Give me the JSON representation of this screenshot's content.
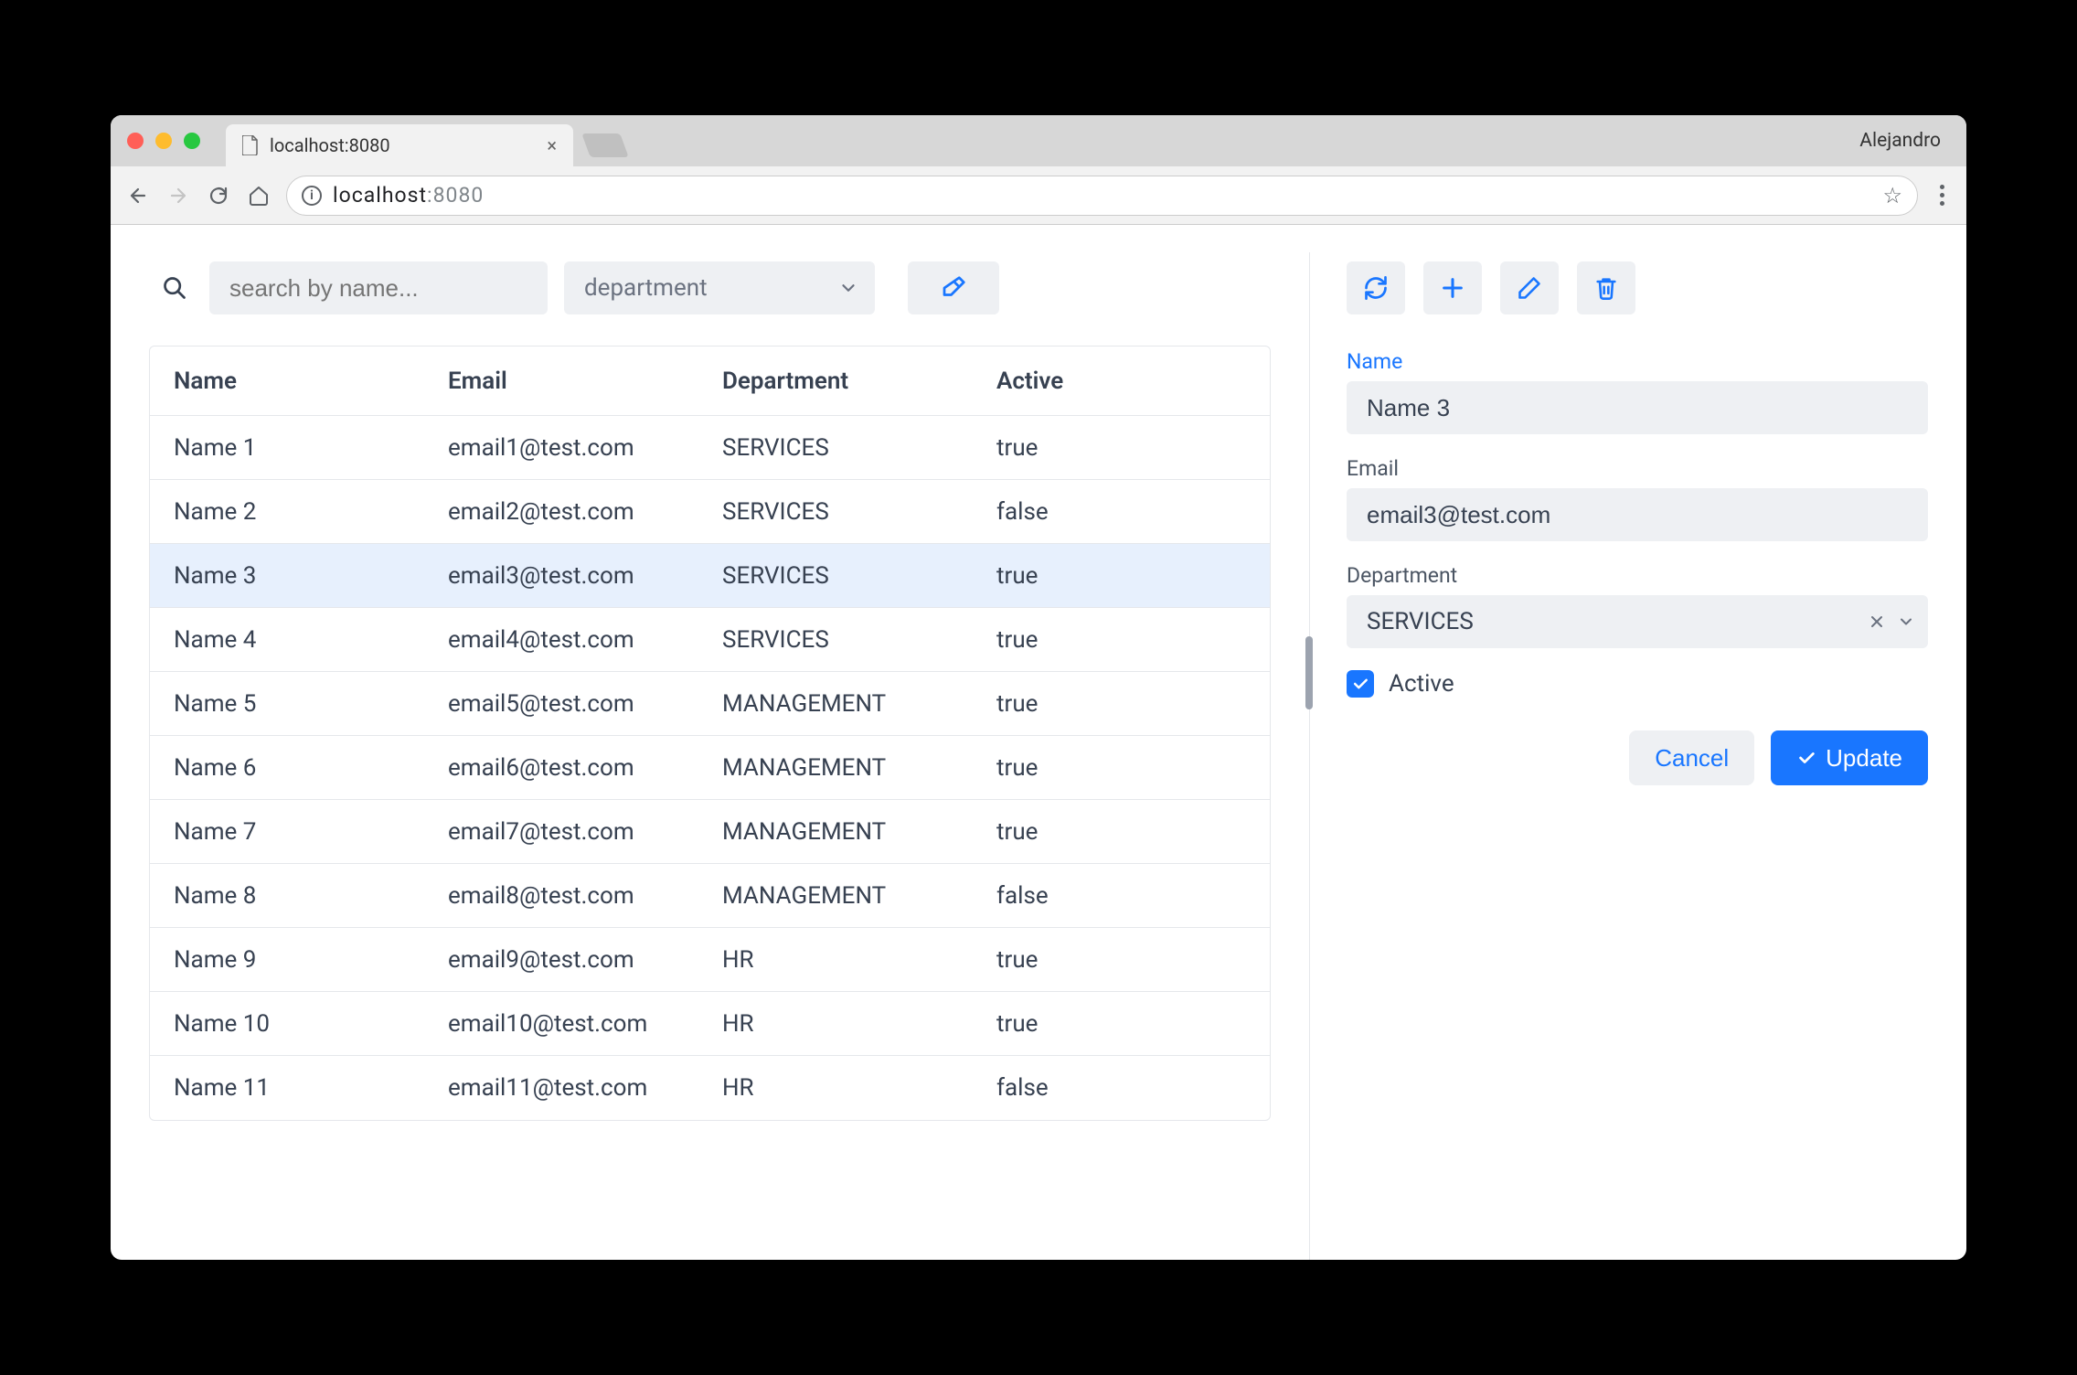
{
  "browser": {
    "tab_title": "localhost:8080",
    "url_host": "localhost",
    "url_port": ":8080",
    "profile": "Alejandro"
  },
  "search": {
    "placeholder": "search by name...",
    "dept_placeholder": "department"
  },
  "table": {
    "headers": {
      "name": "Name",
      "email": "Email",
      "department": "Department",
      "active": "Active"
    },
    "selected_index": 2,
    "rows": [
      {
        "name": "Name 1",
        "email": "email1@test.com",
        "department": "SERVICES",
        "active": "true"
      },
      {
        "name": "Name 2",
        "email": "email2@test.com",
        "department": "SERVICES",
        "active": "false"
      },
      {
        "name": "Name 3",
        "email": "email3@test.com",
        "department": "SERVICES",
        "active": "true"
      },
      {
        "name": "Name 4",
        "email": "email4@test.com",
        "department": "SERVICES",
        "active": "true"
      },
      {
        "name": "Name 5",
        "email": "email5@test.com",
        "department": "MANAGEMENT",
        "active": "true"
      },
      {
        "name": "Name 6",
        "email": "email6@test.com",
        "department": "MANAGEMENT",
        "active": "true"
      },
      {
        "name": "Name 7",
        "email": "email7@test.com",
        "department": "MANAGEMENT",
        "active": "true"
      },
      {
        "name": "Name 8",
        "email": "email8@test.com",
        "department": "MANAGEMENT",
        "active": "false"
      },
      {
        "name": "Name 9",
        "email": "email9@test.com",
        "department": "HR",
        "active": "true"
      },
      {
        "name": "Name 10",
        "email": "email10@test.com",
        "department": "HR",
        "active": "true"
      },
      {
        "name": "Name 11",
        "email": "email11@test.com",
        "department": "HR",
        "active": "false"
      }
    ]
  },
  "form": {
    "name_label": "Name",
    "name_value": "Name 3",
    "email_label": "Email",
    "email_value": "email3@test.com",
    "department_label": "Department",
    "department_value": "SERVICES",
    "active_label": "Active",
    "active_checked": true,
    "cancel_label": "Cancel",
    "update_label": "Update"
  },
  "colors": {
    "primary": "#1976ff",
    "panel_bg": "#eef0f3",
    "selected_row": "#e7f0fd"
  }
}
